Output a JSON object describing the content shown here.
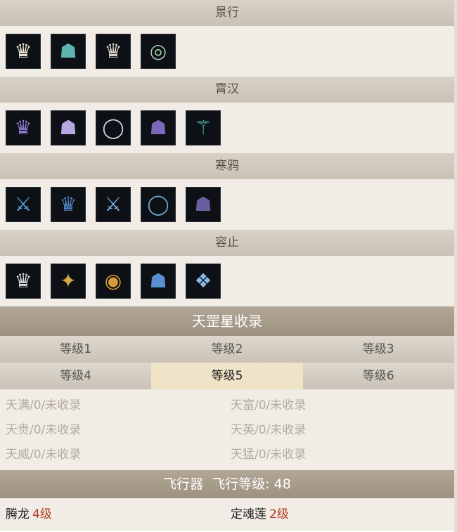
{
  "sets": [
    {
      "name": "景行",
      "items": [
        {
          "icon": "robe-white-icon",
          "color": "#e8e2d2"
        },
        {
          "icon": "cape-teal-icon",
          "color": "#5fb4b0"
        },
        {
          "icon": "robe-white-icon",
          "color": "#d8d4c6"
        },
        {
          "icon": "crown-band-icon",
          "color": "#9ccfa8"
        }
      ]
    },
    {
      "name": "霄汉",
      "items": [
        {
          "icon": "robe-violet-icon",
          "color": "#8b7ad0"
        },
        {
          "icon": "cloak-violet-icon",
          "color": "#b6a6e2"
        },
        {
          "icon": "ring-silver-icon",
          "color": "#c8d2e6"
        },
        {
          "icon": "cape-purple-icon",
          "color": "#7a68b8"
        },
        {
          "icon": "staff-teal-icon",
          "color": "#5cc6c0"
        }
      ]
    },
    {
      "name": "寒鸦",
      "items": [
        {
          "icon": "blade-blue-icon",
          "color": "#5aa6d8"
        },
        {
          "icon": "robe-blue-icon",
          "color": "#4d7fb8"
        },
        {
          "icon": "sword-blue-icon",
          "color": "#7ab2dc"
        },
        {
          "icon": "ring-blue-icon",
          "color": "#6ea7c8"
        },
        {
          "icon": "cloak-dark-icon",
          "color": "#6a5f9e"
        }
      ]
    },
    {
      "name": "容止",
      "items": [
        {
          "icon": "robe-silver-icon",
          "color": "#cfd6dc"
        },
        {
          "icon": "fan-gold-icon",
          "color": "#d6a84a"
        },
        {
          "icon": "ring-gold-icon",
          "color": "#d89a3a"
        },
        {
          "icon": "helm-blue-icon",
          "color": "#5a8ed0"
        },
        {
          "icon": "mask-blue-icon",
          "color": "#86b8e8"
        }
      ]
    }
  ],
  "collection": {
    "title": "天罡星收录",
    "levels_row1": [
      "等级1",
      "等级2",
      "等级3"
    ],
    "levels_row2": [
      "等级4",
      "等级5",
      "等级6"
    ],
    "active_level": "等级5",
    "stars": [
      [
        "天满/0/未收录",
        "天富/0/未收录"
      ],
      [
        "天贵/0/未收录",
        "天英/0/未收录"
      ],
      [
        "天威/0/未收录",
        "天猛/0/未收录"
      ]
    ]
  },
  "flyer": {
    "title": "飞行器  飞行等级: 48",
    "items": [
      {
        "name": "腾龙",
        "level": "4级"
      },
      {
        "name": "定魂莲",
        "level": "2级"
      }
    ]
  }
}
